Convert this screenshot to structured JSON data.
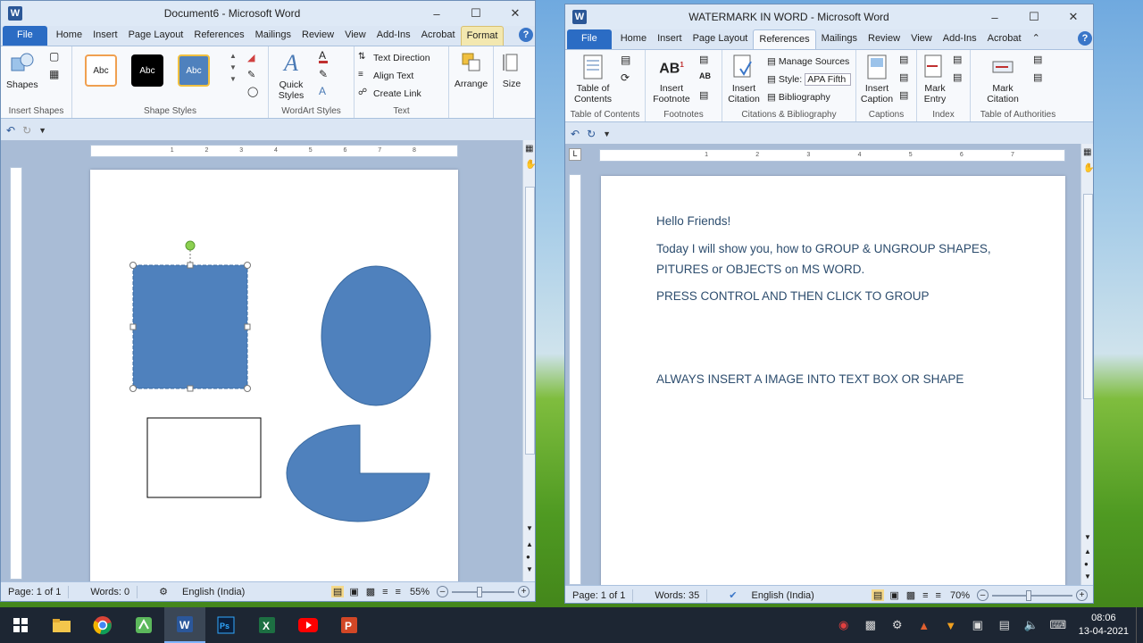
{
  "left_window": {
    "title": "Document6 - Microsoft Word",
    "tabs": [
      "File",
      "Home",
      "Insert",
      "Page Layout",
      "References",
      "Mailings",
      "Review",
      "View",
      "Add-Ins",
      "Acrobat",
      "Format"
    ],
    "active_tab": "Format",
    "ribbon": {
      "insert_shapes": {
        "label": "Insert Shapes",
        "shapes_btn": "Shapes"
      },
      "shape_styles": {
        "label": "Shape Styles",
        "swatches": [
          "Abc",
          "Abc",
          "Abc"
        ]
      },
      "wordart": {
        "label": "WordArt Styles",
        "quick_styles": "Quick Styles"
      },
      "text": {
        "label": "Text",
        "text_direction": "Text Direction",
        "align_text": "Align Text",
        "create_link": "Create Link"
      },
      "arrange": "Arrange",
      "size": "Size"
    },
    "status": {
      "page": "Page: 1 of 1",
      "words": "Words: 0",
      "language": "English (India)",
      "zoom": "55%"
    },
    "colors": {
      "shape_fill": "#4f81bd",
      "shape_stroke": "#3a6aa0"
    }
  },
  "right_window": {
    "title": "WATERMARK IN WORD  -  Microsoft Word",
    "tabs": [
      "File",
      "Home",
      "Insert",
      "Page Layout",
      "References",
      "Mailings",
      "Review",
      "View",
      "Add-Ins",
      "Acrobat"
    ],
    "active_tab": "References",
    "ribbon": {
      "toc": {
        "btn": "Table of Contents",
        "label": "Table of Contents"
      },
      "footnotes": {
        "btn": "Insert Footnote",
        "label": "Footnotes"
      },
      "citations": {
        "btn": "Insert Citation",
        "manage": "Manage Sources",
        "style_label": "Style:",
        "style_value": "APA Fifth",
        "bibliography": "Bibliography",
        "label": "Citations & Bibliography"
      },
      "captions": {
        "btn": "Insert Caption",
        "label": "Captions"
      },
      "index": {
        "btn": "Mark Entry",
        "label": "Index"
      },
      "toa": {
        "btn": "Mark Citation",
        "label": "Table of Authorities"
      }
    },
    "doc_lines": [
      "Hello Friends!",
      "Today I will show you, how to GROUP & UNGROUP SHAPES,",
      "PITURES or OBJECTS on MS WORD.",
      "PRESS CONTROL AND THEN CLICK TO GROUP",
      "ALWAYS INSERT A IMAGE INTO TEXT BOX OR SHAPE"
    ],
    "status": {
      "page": "Page: 1 of 1",
      "words": "Words: 35",
      "language": "English (India)",
      "zoom": "70%"
    }
  },
  "taskbar": {
    "apps": [
      "windows-start",
      "file-explorer",
      "chrome",
      "green-app",
      "word",
      "photoshop",
      "excel",
      "youtube",
      "powerpoint"
    ],
    "time": "08:06",
    "date": "13-04-2021"
  }
}
